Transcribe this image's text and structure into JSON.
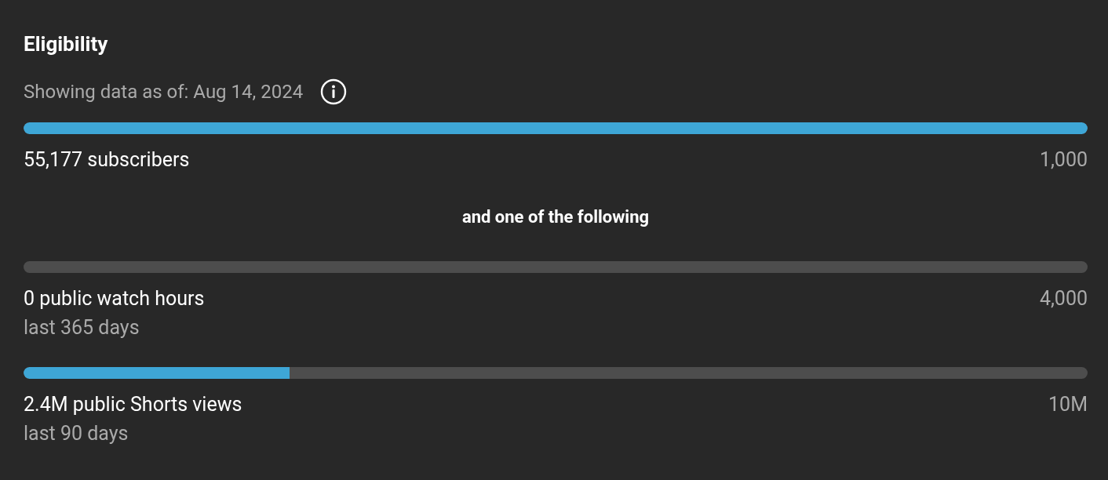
{
  "title": "Eligibility",
  "as_of": "Showing data as of: Aug 14, 2024",
  "requirements": [
    {
      "level": 1,
      "label": "55,177 subscribers",
      "target": "1,000"
    },
    {
      "kind": "separator",
      "text": "and one of the following"
    },
    {
      "level": 0,
      "label": "0 public watch hours",
      "sublabel": "last 365 days",
      "target": "4,000"
    },
    {
      "level": 0.25,
      "label": "2.4M public Shorts views",
      "sublabel": "last 90 days",
      "target": "10M"
    }
  ]
}
